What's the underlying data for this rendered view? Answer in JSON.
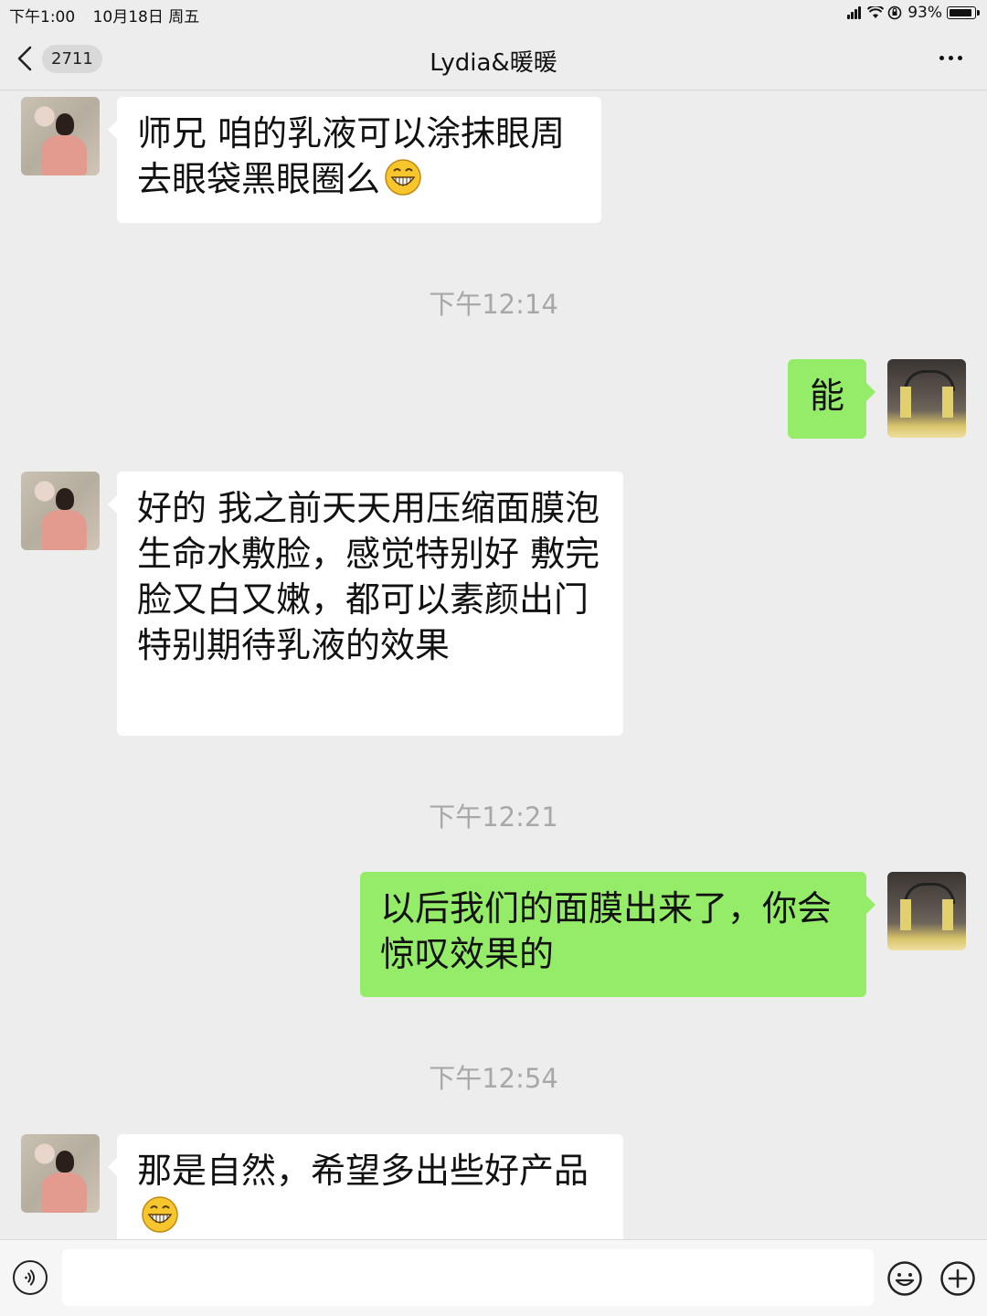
{
  "status_bar": {
    "time": "下午1:00",
    "date": "10月18日 周五",
    "battery_percent": "93%",
    "battery_level": 0.93
  },
  "nav": {
    "back_count": "2711",
    "title": "Lydia&暖暖"
  },
  "messages": [
    {
      "from": "other",
      "text": "师兄 咱的乳液可以涂抹眼周 去眼袋黑眼圈么",
      "emoji": "grin-emoji"
    },
    {
      "from": "me",
      "text": "能"
    },
    {
      "from": "other",
      "text": "好的 我之前天天用压缩面膜泡生命水敷脸，感觉特别好 敷完脸又白又嫩，都可以素颜出门 特别期待乳液的效果"
    },
    {
      "from": "me",
      "text": "以后我们的面膜出来了，你会惊叹效果的"
    },
    {
      "from": "other",
      "text": "那是自然，希望多出些好产品",
      "emoji": "grin-emoji"
    }
  ],
  "timestamps": [
    "下午12:14",
    "下午12:21",
    "下午12:54"
  ],
  "input": {
    "placeholder": ""
  },
  "colors": {
    "background": "#ededed",
    "incoming_bubble": "#ffffff",
    "outgoing_bubble": "#95ec69",
    "timestamp": "#a8a8a8"
  }
}
